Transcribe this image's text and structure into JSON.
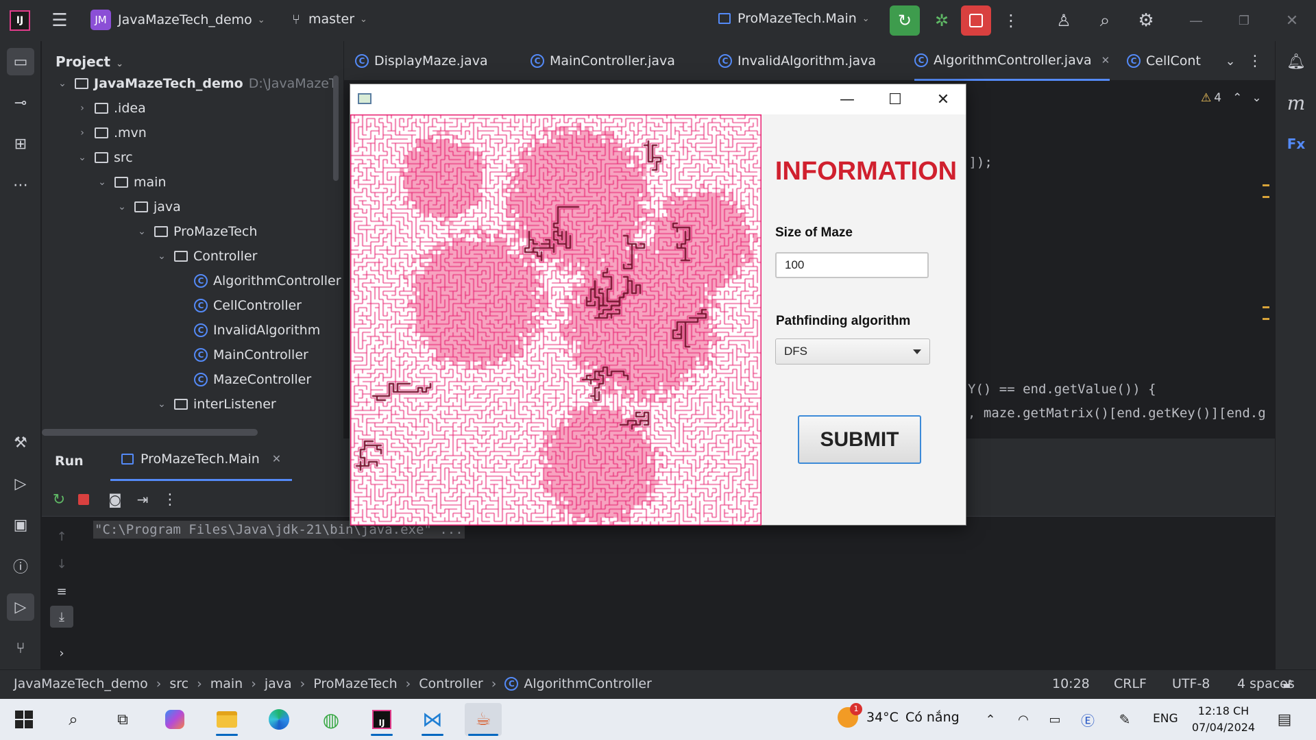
{
  "titlebar": {
    "project_badge": "JM",
    "project_name": "JavaMazeTech_demo",
    "branch": "master",
    "run_config": "ProMazeTech.Main"
  },
  "project_panel": {
    "title": "Project",
    "tree": [
      {
        "label": "JavaMazeTech_demo",
        "extra": "D:\\JavaMazeT",
        "type": "project",
        "arrow": "open"
      },
      {
        "label": ".idea",
        "type": "folder",
        "arrow": "closed"
      },
      {
        "label": ".mvn",
        "type": "folder",
        "arrow": "closed"
      },
      {
        "label": "src",
        "type": "folder",
        "arrow": "open"
      },
      {
        "label": "main",
        "type": "folder",
        "arrow": "open"
      },
      {
        "label": "java",
        "type": "folder",
        "arrow": "open"
      },
      {
        "label": "ProMazeTech",
        "type": "package",
        "arrow": "open"
      },
      {
        "label": "Controller",
        "type": "package",
        "arrow": "open"
      },
      {
        "label": "AlgorithmController",
        "type": "class"
      },
      {
        "label": "CellController",
        "type": "class"
      },
      {
        "label": "InvalidAlgorithm",
        "type": "class"
      },
      {
        "label": "MainController",
        "type": "class"
      },
      {
        "label": "MazeController",
        "type": "class"
      },
      {
        "label": "interListener",
        "type": "package",
        "arrow": "open"
      }
    ]
  },
  "editor": {
    "tabs": [
      "DisplayMaze.java",
      "MainController.java",
      "InvalidAlgorithm.java",
      "AlgorithmController.java",
      "CellCont"
    ],
    "active_tab": "AlgorithmController.java",
    "warnings": "4",
    "code_lines": [
      "]]);",
      "Y() == end.getValue()) {",
      ", maze.getMatrix()[end.getKey()][end.g"
    ]
  },
  "run": {
    "label": "Run",
    "tab": "ProMazeTech.Main",
    "console": "\"C:\\Program Files\\Java\\jdk-21\\bin\\java.exe\" ..."
  },
  "maze_app": {
    "info_title": "INFORMATION",
    "size_label": "Size of Maze",
    "size_value": "100",
    "algo_label": "Pathfinding algorithm",
    "algo_value": "DFS",
    "submit_label": "SUBMIT",
    "colors": {
      "wall": "#e8186c",
      "path": "#7a1230",
      "visited": "#f7a3c0",
      "title": "#d0202e"
    }
  },
  "statusbar": {
    "breadcrumb": [
      "JavaMazeTech_demo",
      "src",
      "main",
      "java",
      "ProMazeTech",
      "Controller",
      "AlgorithmController"
    ],
    "position": "10:28",
    "line_sep": "CRLF",
    "encoding": "UTF-8",
    "indent": "4 spaces"
  },
  "taskbar": {
    "weather_temp": "34°C",
    "weather_text": "Có nắng",
    "lang": "ENG",
    "time": "12:18 CH",
    "date": "07/04/2024",
    "weather_badge": "1"
  }
}
